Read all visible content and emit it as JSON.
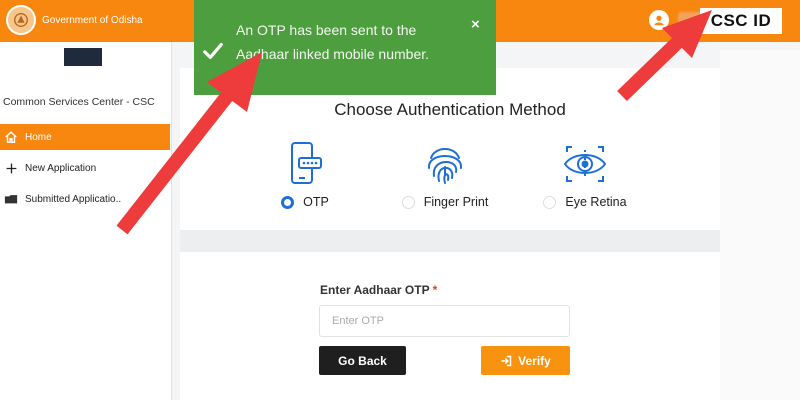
{
  "header": {
    "brand": "Government of Odisha",
    "csc_id": "CSC ID",
    "emblem_icon": "state-emblem-icon",
    "user_icon": "user-icon",
    "color": "#f7870f"
  },
  "sidebar": {
    "title": "Common Services Center - CSC",
    "items": [
      {
        "label": "Home",
        "icon": "home-icon",
        "active": true
      },
      {
        "label": "New Application",
        "icon": "plus-icon",
        "active": false
      },
      {
        "label": "Submitted Applicatio..",
        "icon": "folder-icon",
        "active": false
      }
    ]
  },
  "toast": {
    "message": "An OTP has been sent to the Aadhaar linked mobile number.",
    "close": "×",
    "color": "#4d9e3e"
  },
  "auth": {
    "title": "Choose Authentication Method",
    "methods": [
      {
        "label": "OTP",
        "icon": "phone-otp-icon",
        "selected": true
      },
      {
        "label": "Finger Print",
        "icon": "fingerprint-icon",
        "selected": false
      },
      {
        "label": "Eye Retina",
        "icon": "eye-retina-icon",
        "selected": false
      }
    ]
  },
  "form": {
    "otp_label": "Enter Aadhaar OTP",
    "required_mark": "*",
    "otp_placeholder": "Enter OTP",
    "back_label": "Go Back",
    "verify_label": "Verify",
    "verify_color": "#f7930f"
  }
}
